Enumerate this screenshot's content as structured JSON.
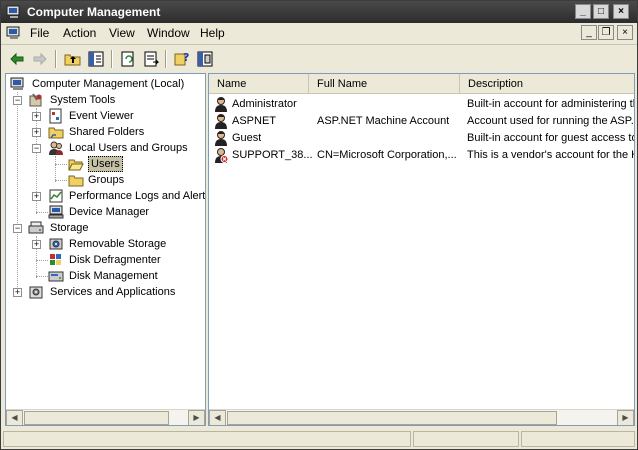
{
  "window": {
    "title": "Computer Management"
  },
  "menu": [
    "File",
    "Action",
    "View",
    "Window",
    "Help"
  ],
  "tree": {
    "root": "Computer Management (Local)",
    "system_tools": "System Tools",
    "event_viewer": "Event Viewer",
    "shared_folders": "Shared Folders",
    "local_users_groups": "Local Users and Groups",
    "users": "Users",
    "groups": "Groups",
    "perf_logs": "Performance Logs and Alerts",
    "device_manager": "Device Manager",
    "storage": "Storage",
    "removable_storage": "Removable Storage",
    "disk_defrag": "Disk Defragmenter",
    "disk_management": "Disk Management",
    "services_apps": "Services and Applications"
  },
  "list": {
    "columns": [
      "Name",
      "Full Name",
      "Description"
    ],
    "rows": [
      {
        "name": "Administrator",
        "full_name": "",
        "description": "Built-in account for administering the",
        "icon": "user-icon"
      },
      {
        "name": "ASPNET",
        "full_name": "ASP.NET Machine Account",
        "description": "Account used for running the ASP.N",
        "icon": "user-icon"
      },
      {
        "name": "Guest",
        "full_name": "",
        "description": "Built-in account for guest access to th",
        "icon": "user-icon"
      },
      {
        "name": "SUPPORT_38...",
        "full_name": "CN=Microsoft Corporation,...",
        "description": "This is a vendor's account for the Help",
        "icon": "disabled-user-icon"
      }
    ]
  },
  "colors": {
    "titlebar": "#2c2c2c",
    "selection": "#c5c2a8",
    "window_bg": "#ece9d8"
  }
}
